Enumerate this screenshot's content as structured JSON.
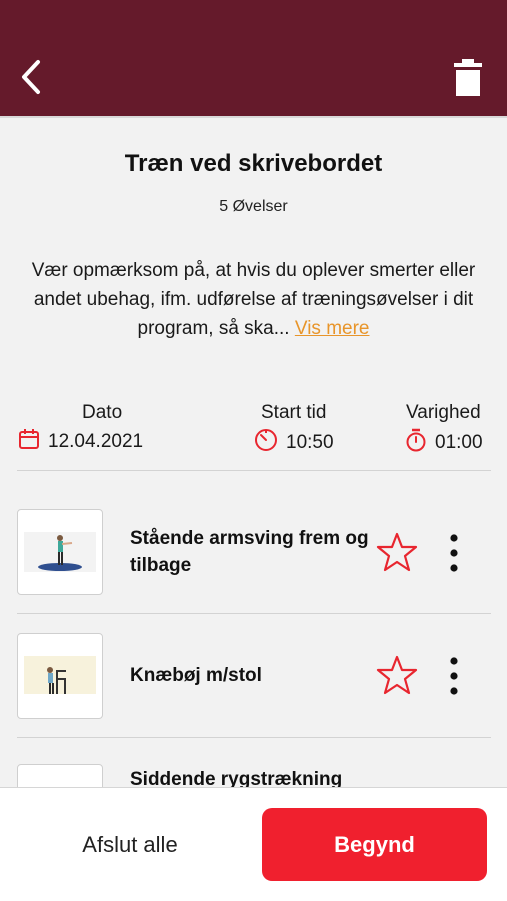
{
  "colors": {
    "brand": "#651a2b",
    "primary": "#f0202e",
    "accent": "#e8952a",
    "icon_red": "#e8262f"
  },
  "header": {
    "back_icon": "chevron-left-icon",
    "delete_icon": "trash-icon"
  },
  "program": {
    "title": "Træn ved skrivebordet",
    "count": "5 Øvelser",
    "description": "Vær opmærksom på, at hvis du oplever smerter eller andet ubehag, ifm. udførelse af træningsøvelser i dit program, så ska...",
    "more": "Vis mere"
  },
  "meta": {
    "date": {
      "label": "Dato",
      "value": "12.04.2021",
      "icon": "calendar-icon"
    },
    "start": {
      "label": "Start tid",
      "value": "10:50",
      "icon": "clock-icon"
    },
    "duration": {
      "label": "Varighed",
      "value": "01:00",
      "icon": "stopwatch-icon"
    }
  },
  "exercises": [
    {
      "name": "Stående armsving frem og tilbage"
    },
    {
      "name": "Knæbøj m/stol"
    },
    {
      "name": "Siddende rygstrækning"
    }
  ],
  "footer": {
    "secondary": "Afslut alle",
    "primary": "Begynd"
  }
}
